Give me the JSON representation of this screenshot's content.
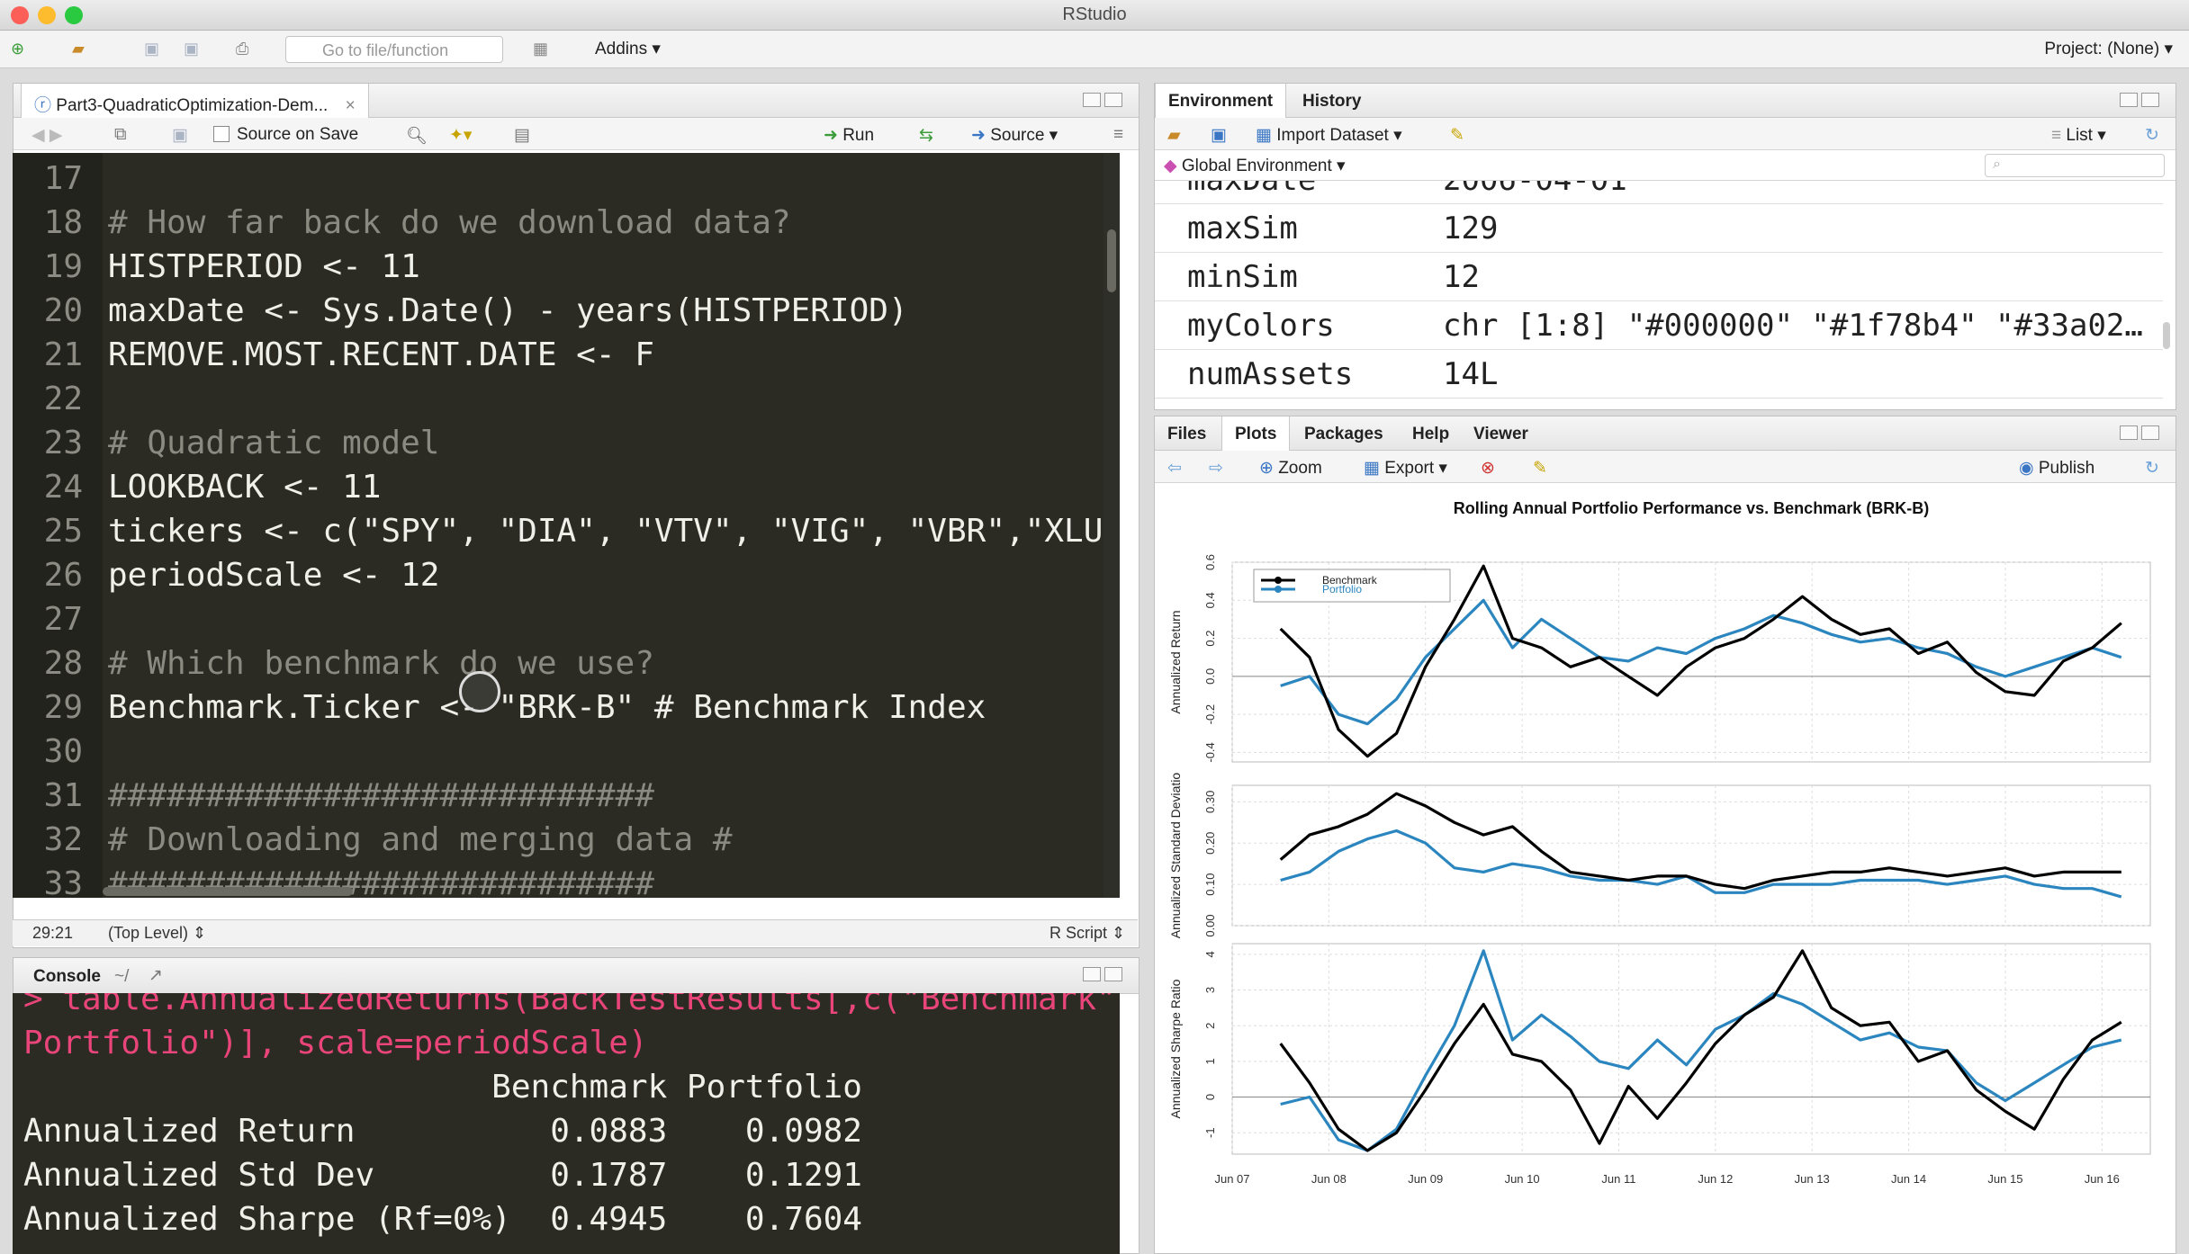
{
  "window": {
    "title": "RStudio"
  },
  "toolbar": {
    "goto_placeholder": "Go to file/function",
    "addins": "Addins",
    "project": "Project: (None)"
  },
  "editor": {
    "tab": "Part3-QuadraticOptimization-Dem...",
    "source_on_save": "Source on Save",
    "run": "Run",
    "source": "Source",
    "lines": [
      {
        "n": "17",
        "text": ""
      },
      {
        "n": "18",
        "text": "# How far back do we download data?"
      },
      {
        "n": "19",
        "text": "HISTPERIOD <- 11"
      },
      {
        "n": "20",
        "text": "maxDate <- Sys.Date() - years(HISTPERIOD)"
      },
      {
        "n": "21",
        "text": "REMOVE.MOST.RECENT.DATE <- F"
      },
      {
        "n": "22",
        "text": ""
      },
      {
        "n": "23",
        "text": "# Quadratic model"
      },
      {
        "n": "24",
        "text": "LOOKBACK <- 11"
      },
      {
        "n": "25",
        "text": "tickers <- c(\"SPY\", \"DIA\", \"VTV\", \"VIG\", \"VBR\",\"XLU\", \"X"
      },
      {
        "n": "26",
        "text": "periodScale <- 12"
      },
      {
        "n": "27",
        "text": ""
      },
      {
        "n": "28",
        "text": "# Which benchmark do we use?"
      },
      {
        "n": "29",
        "text": "Benchmark.Ticker <- \"BRK-B\" # Benchmark Index"
      },
      {
        "n": "30",
        "text": ""
      },
      {
        "n": "31",
        "text": "############################"
      },
      {
        "n": "32",
        "text": "# Downloading and merging data #"
      },
      {
        "n": "33",
        "text": "############################"
      }
    ],
    "status_pos": "29:21",
    "status_scope": "(Top Level)",
    "status_type": "R Script"
  },
  "console": {
    "title": "Console",
    "path": "~/",
    "lines": [
      "> table.AnnualizedReturns(BackTestResults[,c(\"Benchmark\", \"",
      "Portfolio\")], scale=periodScale)",
      "                        Benchmark Portfolio",
      "Annualized Return          0.0883    0.0982",
      "Annualized Std Dev         0.1787    0.1291",
      "Annualized Sharpe (Rf=0%)  0.4945    0.7604"
    ]
  },
  "environment": {
    "tabs": [
      "Environment",
      "History"
    ],
    "import": "Import Dataset",
    "list": "List",
    "scope": "Global Environment",
    "rows": [
      {
        "name": "maxDate",
        "value": "2006-04-01"
      },
      {
        "name": "maxSim",
        "value": "129"
      },
      {
        "name": "minSim",
        "value": "12"
      },
      {
        "name": "myColors",
        "value": "chr [1:8] \"#000000\" \"#1f78b4\" \"#33a02…"
      },
      {
        "name": "numAssets",
        "value": "14L"
      }
    ]
  },
  "files": {
    "tabs": [
      "Files",
      "Plots",
      "Packages",
      "Help",
      "Viewer"
    ],
    "zoom": "Zoom",
    "export": "Export",
    "publish": "Publish"
  },
  "colors": {
    "benchmark": "#000000",
    "portfolio": "#2b86bf"
  },
  "chart_data": [
    {
      "type": "line",
      "title": "Rolling Annual Portfolio Performance vs. Benchmark (BRK-B)",
      "ylabel": "Annualized Return",
      "ylim": [
        -0.45,
        0.6
      ],
      "yticks": [
        "-0.4",
        "-0.2",
        "0.0",
        "0.2",
        "0.4",
        "0.6"
      ],
      "xticks": [
        "Jun 07",
        "Jun 08",
        "Jun 09",
        "Jun 10",
        "Jun 11",
        "Jun 12",
        "Jun 13",
        "Jun 14",
        "Jun 15",
        "Jun 16"
      ],
      "legend": [
        "Benchmark",
        "Portfolio"
      ],
      "legend_position": "top-left",
      "x": [
        2008.0,
        2008.3,
        2008.6,
        2008.9,
        2009.2,
        2009.5,
        2009.8,
        2010.1,
        2010.4,
        2010.7,
        2011.0,
        2011.3,
        2011.6,
        2011.9,
        2012.2,
        2012.5,
        2012.8,
        2013.1,
        2013.4,
        2013.7,
        2014.0,
        2014.3,
        2014.6,
        2014.9,
        2015.2,
        2015.5,
        2015.8,
        2016.1,
        2016.4,
        2016.7
      ],
      "series": [
        {
          "name": "Benchmark",
          "values": [
            0.25,
            0.1,
            -0.28,
            -0.42,
            -0.3,
            0.05,
            0.3,
            0.58,
            0.2,
            0.15,
            0.05,
            0.1,
            0.0,
            -0.1,
            0.05,
            0.15,
            0.2,
            0.3,
            0.42,
            0.3,
            0.22,
            0.25,
            0.12,
            0.18,
            0.02,
            -0.08,
            -0.1,
            0.08,
            0.15,
            0.28
          ]
        },
        {
          "name": "Portfolio",
          "values": [
            -0.05,
            0.0,
            -0.2,
            -0.25,
            -0.12,
            0.1,
            0.25,
            0.4,
            0.15,
            0.3,
            0.2,
            0.1,
            0.08,
            0.15,
            0.12,
            0.2,
            0.25,
            0.32,
            0.28,
            0.22,
            0.18,
            0.2,
            0.15,
            0.12,
            0.05,
            0.0,
            0.05,
            0.1,
            0.15,
            0.1
          ]
        }
      ]
    },
    {
      "type": "line",
      "ylabel": "Annualized Standard Deviatio",
      "ylim": [
        0.0,
        0.34
      ],
      "yticks": [
        "0.00",
        "0.10",
        "0.20",
        "0.30"
      ],
      "x": [
        2008.0,
        2008.3,
        2008.6,
        2008.9,
        2009.2,
        2009.5,
        2009.8,
        2010.1,
        2010.4,
        2010.7,
        2011.0,
        2011.3,
        2011.6,
        2011.9,
        2012.2,
        2012.5,
        2012.8,
        2013.1,
        2013.4,
        2013.7,
        2014.0,
        2014.3,
        2014.6,
        2014.9,
        2015.2,
        2015.5,
        2015.8,
        2016.1,
        2016.4,
        2016.7
      ],
      "series": [
        {
          "name": "Benchmark",
          "values": [
            0.16,
            0.22,
            0.24,
            0.27,
            0.32,
            0.29,
            0.25,
            0.22,
            0.24,
            0.18,
            0.13,
            0.12,
            0.11,
            0.12,
            0.12,
            0.1,
            0.09,
            0.11,
            0.12,
            0.13,
            0.13,
            0.14,
            0.13,
            0.12,
            0.13,
            0.14,
            0.12,
            0.13,
            0.13,
            0.13
          ]
        },
        {
          "name": "Portfolio",
          "values": [
            0.11,
            0.13,
            0.18,
            0.21,
            0.23,
            0.2,
            0.14,
            0.13,
            0.15,
            0.14,
            0.12,
            0.11,
            0.11,
            0.1,
            0.12,
            0.08,
            0.08,
            0.1,
            0.1,
            0.1,
            0.11,
            0.11,
            0.11,
            0.1,
            0.11,
            0.12,
            0.1,
            0.09,
            0.09,
            0.07
          ]
        }
      ]
    },
    {
      "type": "line",
      "ylabel": "Annualized Sharpe Ratio",
      "ylim": [
        -1.6,
        4.3
      ],
      "yticks": [
        "-1",
        "0",
        "1",
        "2",
        "3",
        "4"
      ],
      "x": [
        2008.0,
        2008.3,
        2008.6,
        2008.9,
        2009.2,
        2009.5,
        2009.8,
        2010.1,
        2010.4,
        2010.7,
        2011.0,
        2011.3,
        2011.6,
        2011.9,
        2012.2,
        2012.5,
        2012.8,
        2013.1,
        2013.4,
        2013.7,
        2014.0,
        2014.3,
        2014.6,
        2014.9,
        2015.2,
        2015.5,
        2015.8,
        2016.1,
        2016.4,
        2016.7
      ],
      "series": [
        {
          "name": "Benchmark",
          "values": [
            1.5,
            0.4,
            -0.9,
            -1.5,
            -1.0,
            0.2,
            1.5,
            2.6,
            1.2,
            1.0,
            0.2,
            -1.3,
            0.3,
            -0.6,
            0.4,
            1.5,
            2.3,
            2.8,
            4.1,
            2.5,
            2.0,
            2.1,
            1.0,
            1.3,
            0.2,
            -0.4,
            -0.9,
            0.5,
            1.6,
            2.1
          ]
        },
        {
          "name": "Portfolio",
          "values": [
            -0.2,
            0.0,
            -1.2,
            -1.5,
            -0.9,
            0.6,
            2.0,
            4.1,
            1.6,
            2.3,
            1.7,
            1.0,
            0.8,
            1.6,
            0.9,
            1.9,
            2.3,
            2.9,
            2.6,
            2.1,
            1.6,
            1.8,
            1.4,
            1.3,
            0.4,
            -0.1,
            0.4,
            0.9,
            1.4,
            1.6
          ]
        }
      ]
    }
  ]
}
